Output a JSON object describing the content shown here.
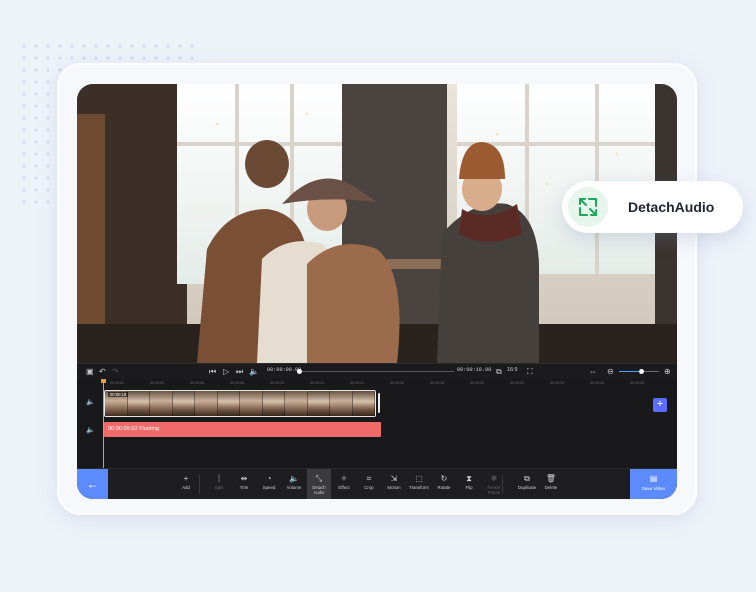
{
  "overlay_label": "DetachAudio",
  "player": {
    "current_time": "00:00:00.00",
    "total_time": "00:00:18.08",
    "aspect_ratio": "16:9",
    "playhead_progress": 0.0,
    "zoom_level": 0.55
  },
  "ruler_ticks": [
    "00:00:02",
    "00:00:04",
    "00:00:06",
    "00:00:08",
    "00:00:10",
    "00:00:12",
    "00:00:14",
    "00:00:16",
    "00:00:18",
    "00:00:20",
    "00:00:22",
    "00:00:24",
    "00:00:26",
    "00:00:28"
  ],
  "video_clip": {
    "duration": "00:00:18"
  },
  "audio_clip": {
    "label": "00:00:05:02 Floating"
  },
  "tools": [
    {
      "id": "add",
      "label": "Add",
      "glyph": "+"
    },
    {
      "id": "split",
      "label": "Split",
      "glyph": "⫿",
      "disabled": true
    },
    {
      "id": "trim",
      "label": "Trim",
      "glyph": "⇹"
    },
    {
      "id": "speed",
      "label": "Speed",
      "glyph": "◔"
    },
    {
      "id": "volume",
      "label": "Volume",
      "glyph": "🔈"
    },
    {
      "id": "detach-audio",
      "label": "Detach Audio",
      "glyph": "⤡",
      "active": true
    },
    {
      "id": "effect",
      "label": "Effect",
      "glyph": "✧"
    },
    {
      "id": "crop",
      "label": "Crop",
      "glyph": "⌗"
    },
    {
      "id": "motion",
      "label": "Motion",
      "glyph": "⇲"
    },
    {
      "id": "transform",
      "label": "Transform",
      "glyph": "⬚"
    },
    {
      "id": "rotate",
      "label": "Rotate",
      "glyph": "↻"
    },
    {
      "id": "flip",
      "label": "Flip",
      "glyph": "⧗"
    },
    {
      "id": "freeze-frame",
      "label": "Freeze Frame",
      "glyph": "❄",
      "disabled": true
    },
    {
      "id": "duplicate",
      "label": "Duplicate",
      "glyph": "⧉"
    },
    {
      "id": "delete",
      "label": "Delete",
      "glyph": "🗑"
    }
  ],
  "save_label": "Save Video",
  "colors": {
    "accent": "#5c8bff",
    "audio_track": "#f06a6a",
    "playhead": "#e89b3a",
    "badge_icon": "#1aa85a"
  }
}
